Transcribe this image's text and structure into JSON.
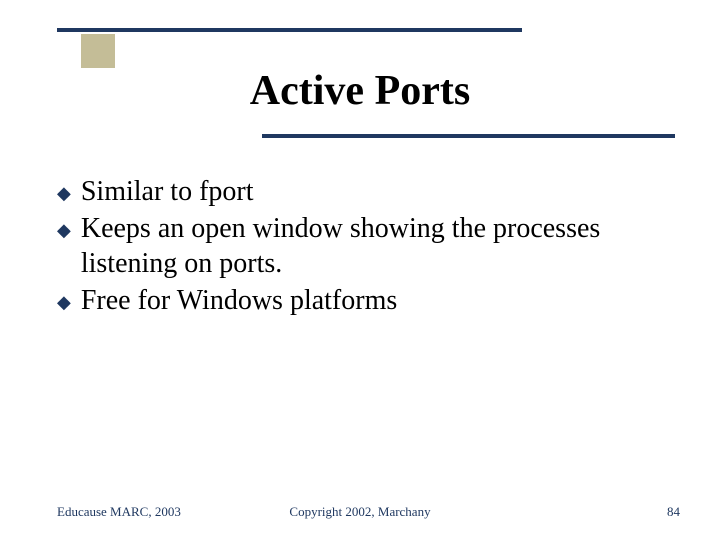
{
  "title": "Active Ports",
  "bullets": [
    "Similar to fport",
    "Keeps an open window showing the processes listening on ports.",
    "Free for Windows platforms"
  ],
  "footer": {
    "left": "Educause MARC, 2003",
    "center": "Copyright 2002, Marchany",
    "right": "84"
  }
}
